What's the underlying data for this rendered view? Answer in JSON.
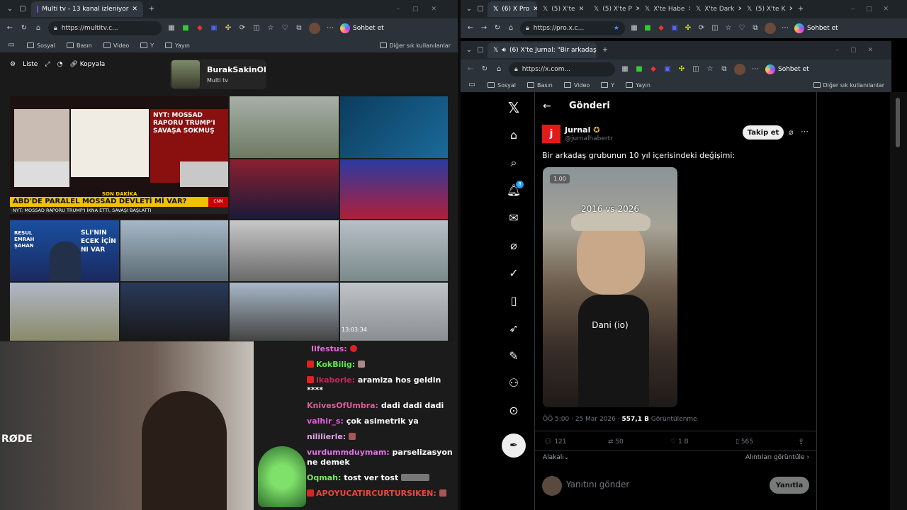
{
  "left_browser": {
    "tabs": [
      {
        "label": "Multi tv - 13 kanal izleniyor"
      }
    ],
    "url": "https://multitv.c...",
    "chat_button": "Sohbet et",
    "bookmarks": [
      "Sosyal",
      "Basın",
      "Video",
      "Y",
      "Yayın"
    ],
    "bookmarks_right": "Diğer sık kullanılanlar"
  },
  "multitv": {
    "controls": {
      "list": "Liste",
      "copy": "Kopyala"
    },
    "channel_name": "BurakSakinOl",
    "channel_sub": "Multi tv",
    "tiles": {
      "cnn_headline": "NYT: MOSSAD RAPORU TRUMP'I SAVAŞA SOKMUŞ",
      "cnn_breaking": "SON DAKİKA",
      "cnn_title": "ABD'DE PARALEL MOSSAD DEVLETİ Mİ VAR?",
      "cnn_ticker": "NYT: MOSSAD RAPORU TRUMP'I İKNA ETTİ, SAVAŞI BAŞLATTI",
      "cnn_logo": "CNN TÜRK",
      "resul_name": "RESUL EMRAH ŞAHAN",
      "resul_text": "SLI'NIN ECEK İÇİN NI VAR",
      "cam_time": "13:03:34"
    }
  },
  "chat": {
    "messages": [
      {
        "user": "Ilfestus:",
        "text": "",
        "color": "#e26ad8"
      },
      {
        "user": "KokBilig:",
        "text": "",
        "color": "#61e84b"
      },
      {
        "user": "ikaborie:",
        "text": "aramiza hos geldin ****",
        "color": "#c9245a"
      },
      {
        "user": "KnivesOfUmbra:",
        "text": "dadi dadi dadi",
        "color": "#e25a9a"
      },
      {
        "user": "valhir_s:",
        "text": "çok asimetrik ya",
        "color": "#ea5be0"
      },
      {
        "user": "nililierle:",
        "text": "",
        "color": "#e2a0e8"
      },
      {
        "user": "vurdummduymam:",
        "text": "parselizasyon ne demek",
        "color": "#e072e8"
      },
      {
        "user": "Oqmah:",
        "text": "tost ver tost",
        "color": "#7ce95d"
      },
      {
        "user": "APOYUCATIRCURTURSIKEN:",
        "text": "",
        "color": "#e84a3a"
      }
    ],
    "webcam_mic_brand": "RØDE"
  },
  "right_browser": {
    "tabs": [
      {
        "label": "(6) X Pro"
      },
      {
        "label": "(5) X'te"
      },
      {
        "label": "(5) X'te P"
      },
      {
        "label": "X'te Habe"
      },
      {
        "label": "X'te Dark"
      },
      {
        "label": "(5) X'te K"
      }
    ],
    "url": "https://pro.x.c...",
    "chat_button": "Sohbet et",
    "inner": {
      "tab": "(6) X'te Jurnal: \"Bir arkadaş gr",
      "url": "https://x.com...",
      "chat_button": "Sohbet et",
      "bookmarks": [
        "Sosyal",
        "Basın",
        "Video",
        "Y",
        "Yayın"
      ],
      "bookmarks_right": "Diğer sık kullanılanlar"
    }
  },
  "tweet": {
    "page_title": "Gönderi",
    "author": "Jurnal",
    "handle": "@jurnalhabertr",
    "follow": "Takip et",
    "text": "Bir arkadaş grubunun 10 yıl içerisindeki değişimi:",
    "video_speed": "1.00",
    "video_caption_top": "2016 vs 2026",
    "video_caption_mid": "Dani (io)",
    "time": "ÖÖ 5:00 · 25 Mar 2026 ·",
    "views_count": "557,1 B",
    "views_label": "Görüntülenme",
    "replies": "121",
    "retweets": "50",
    "likes": "1 B",
    "bookmarks": "565",
    "sort": "Alakalı",
    "quotes_link": "Alıntıları görüntüle",
    "reply_placeholder": "Yanıtını gönder",
    "reply_button": "Yanıtla",
    "notification_count": "8"
  }
}
